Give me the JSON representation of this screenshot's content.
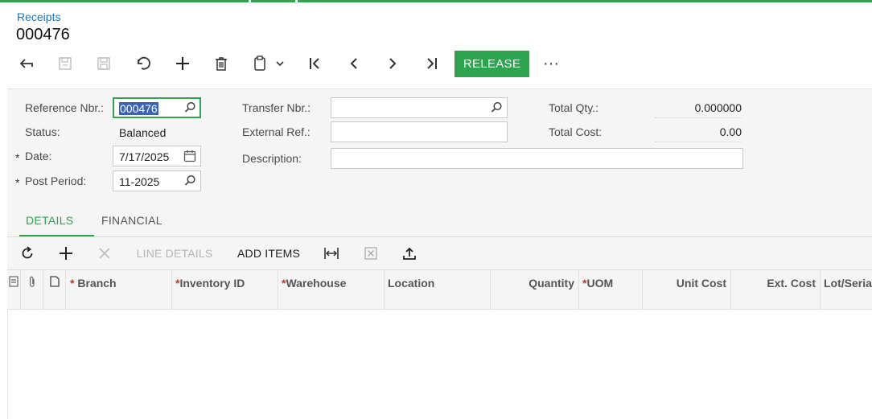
{
  "breadcrumb": "Receipts",
  "doc_number": "000476",
  "toolbar": {
    "back_icon": "arrow-back-icon",
    "save_close_icon": "save-close-icon",
    "save_icon": "save-icon",
    "undo_icon": "undo-icon",
    "add_icon": "plus-icon",
    "delete_icon": "trash-icon",
    "clipboard_icon": "clipboard-icon",
    "first_icon": "first-record-icon",
    "prev_icon": "chevron-left-icon",
    "next_icon": "chevron-right-icon",
    "last_icon": "last-record-icon",
    "release_label": "RELEASE",
    "more_label": "···"
  },
  "form": {
    "reference_nbr_label": "Reference Nbr.:",
    "reference_nbr_value": "000476",
    "status_label": "Status:",
    "status_value": "Balanced",
    "date_label": "Date:",
    "date_value": "7/17/2025",
    "post_period_label": "Post Period:",
    "post_period_value": "11-2025",
    "transfer_nbr_label": "Transfer Nbr.:",
    "transfer_nbr_value": "",
    "external_ref_label": "External Ref.:",
    "external_ref_value": "",
    "description_label": "Description:",
    "description_value": "",
    "total_qty_label": "Total Qty.:",
    "total_qty_value": "0.000000",
    "total_cost_label": "Total Cost:",
    "total_cost_value": "0.00",
    "required_marker": "*"
  },
  "tabs": [
    {
      "label": "DETAILS",
      "active": true
    },
    {
      "label": "FINANCIAL",
      "active": false
    }
  ],
  "grid_toolbar": {
    "refresh_icon": "refresh-icon",
    "add_icon": "plus-icon",
    "delete_icon": "close-icon",
    "line_details_label": "LINE DETAILS",
    "add_items_label": "ADD ITEMS",
    "fit_width_icon": "fit-width-icon",
    "excel_icon": "excel-export-icon",
    "upload_icon": "upload-icon"
  },
  "grid_columns": [
    {
      "label": "Branch",
      "required": true
    },
    {
      "label": "Inventory ID",
      "required": true
    },
    {
      "label": "Warehouse",
      "required": true
    },
    {
      "label": "Location",
      "required": false
    },
    {
      "label": "Quantity",
      "required": false
    },
    {
      "label": "UOM",
      "required": true
    },
    {
      "label": "Unit Cost",
      "required": false
    },
    {
      "label": "Ext. Cost",
      "required": false
    },
    {
      "label": "Lot/Serial",
      "required": false
    }
  ],
  "colors": {
    "accent": "#2ea44f",
    "link": "#1a73b8",
    "required": "#c0392b"
  }
}
